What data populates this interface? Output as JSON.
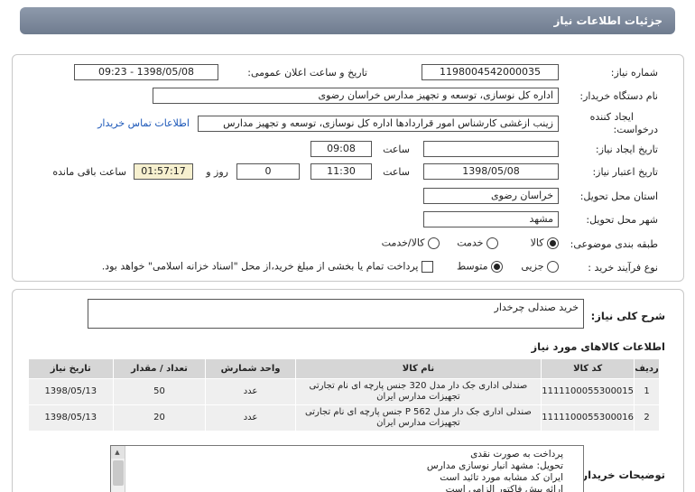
{
  "header": {
    "title": "جزئیات اطلاعات نیاز"
  },
  "details": {
    "need_number": {
      "label": "شماره نیاز:",
      "value": "1198004542000035"
    },
    "announce_datetime": {
      "label": "تاریخ و ساعت اعلان عمومی:",
      "value": "1398/05/08 - 09:23"
    },
    "buyer_org": {
      "label": "نام دستگاه خریدار:",
      "value": "اداره کل نوسازی، توسعه و تجهیز مدارس خراسان رضوی"
    },
    "requester": {
      "label_line1": "ایجاد کننده",
      "label_line2": "درخواست:",
      "value": "زینب ازغشی کارشناس امور قراردادها اداره کل نوسازی، توسعه و تجهیز مدارس",
      "contact_link": "اطلاعات تماس خریدار"
    },
    "need_date": {
      "label": "تاریخ ایجاد نیاز:",
      "date": "1398/05/08",
      "time_label": "ساعت",
      "time": "09:08"
    },
    "validity": {
      "label": "تاریخ اعتبار نیاز:",
      "date": "1398/05/08",
      "time_label": "ساعت",
      "time": "11:30",
      "days": "0",
      "days_label": "روز و",
      "remaining": "01:57:17",
      "remaining_label": "ساعت باقی مانده"
    },
    "province": {
      "label": "استان محل تحویل:",
      "value": "خراسان رضوی"
    },
    "city": {
      "label": "شهر محل تحویل:",
      "value": "مشهد"
    },
    "category": {
      "label": "طبقه بندی موضوعی:",
      "options": [
        "کالا",
        "خدمت",
        "کالا/خدمت"
      ],
      "selected": "کالا"
    },
    "process": {
      "label": "نوع فرآیند خرید :",
      "options": [
        "جزیی",
        "متوسط"
      ],
      "selected": "متوسط",
      "checkbox_text": "پرداخت تمام یا بخشی از مبلغ خرید،از محل \"اسناد خزانه اسلامی\" خواهد بود."
    }
  },
  "summary": {
    "label": "شرح کلی نیاز:",
    "value": "خرید صندلی چرخدار"
  },
  "goods": {
    "title": "اطلاعات کالاهای مورد نیاز",
    "columns": [
      "ردیف",
      "کد کالا",
      "نام کالا",
      "واحد شمارش",
      "تعداد / مقدار",
      "تاریخ نیاز"
    ],
    "rows": [
      {
        "row": "1",
        "code": "1111100055300015",
        "name_line1": "صندلی اداری جک دار مدل 320 جنس پارچه ای نام تجارتی",
        "name_line2": "تجهیزات مدارس ایران",
        "unit": "عدد",
        "qty": "50",
        "date": "1398/05/13"
      },
      {
        "row": "2",
        "code": "1111100055300016",
        "name_line1": "صندلی اداری جک دار مدل P 562 جنس پارچه ای نام تجارتی",
        "name_line2": "تجهیزات مدارس ایران",
        "unit": "عدد",
        "qty": "20",
        "date": "1398/05/13"
      }
    ]
  },
  "buyer_notes": {
    "label": "توضیحات خریدار:",
    "lines": [
      "پرداخت به صورت نقدی",
      "تحویل: مشهد انبار نوسازی مدارس",
      "ایران کد مشابه مورد تائید است",
      "ارائه پیش فاکتور الزامی است"
    ]
  }
}
